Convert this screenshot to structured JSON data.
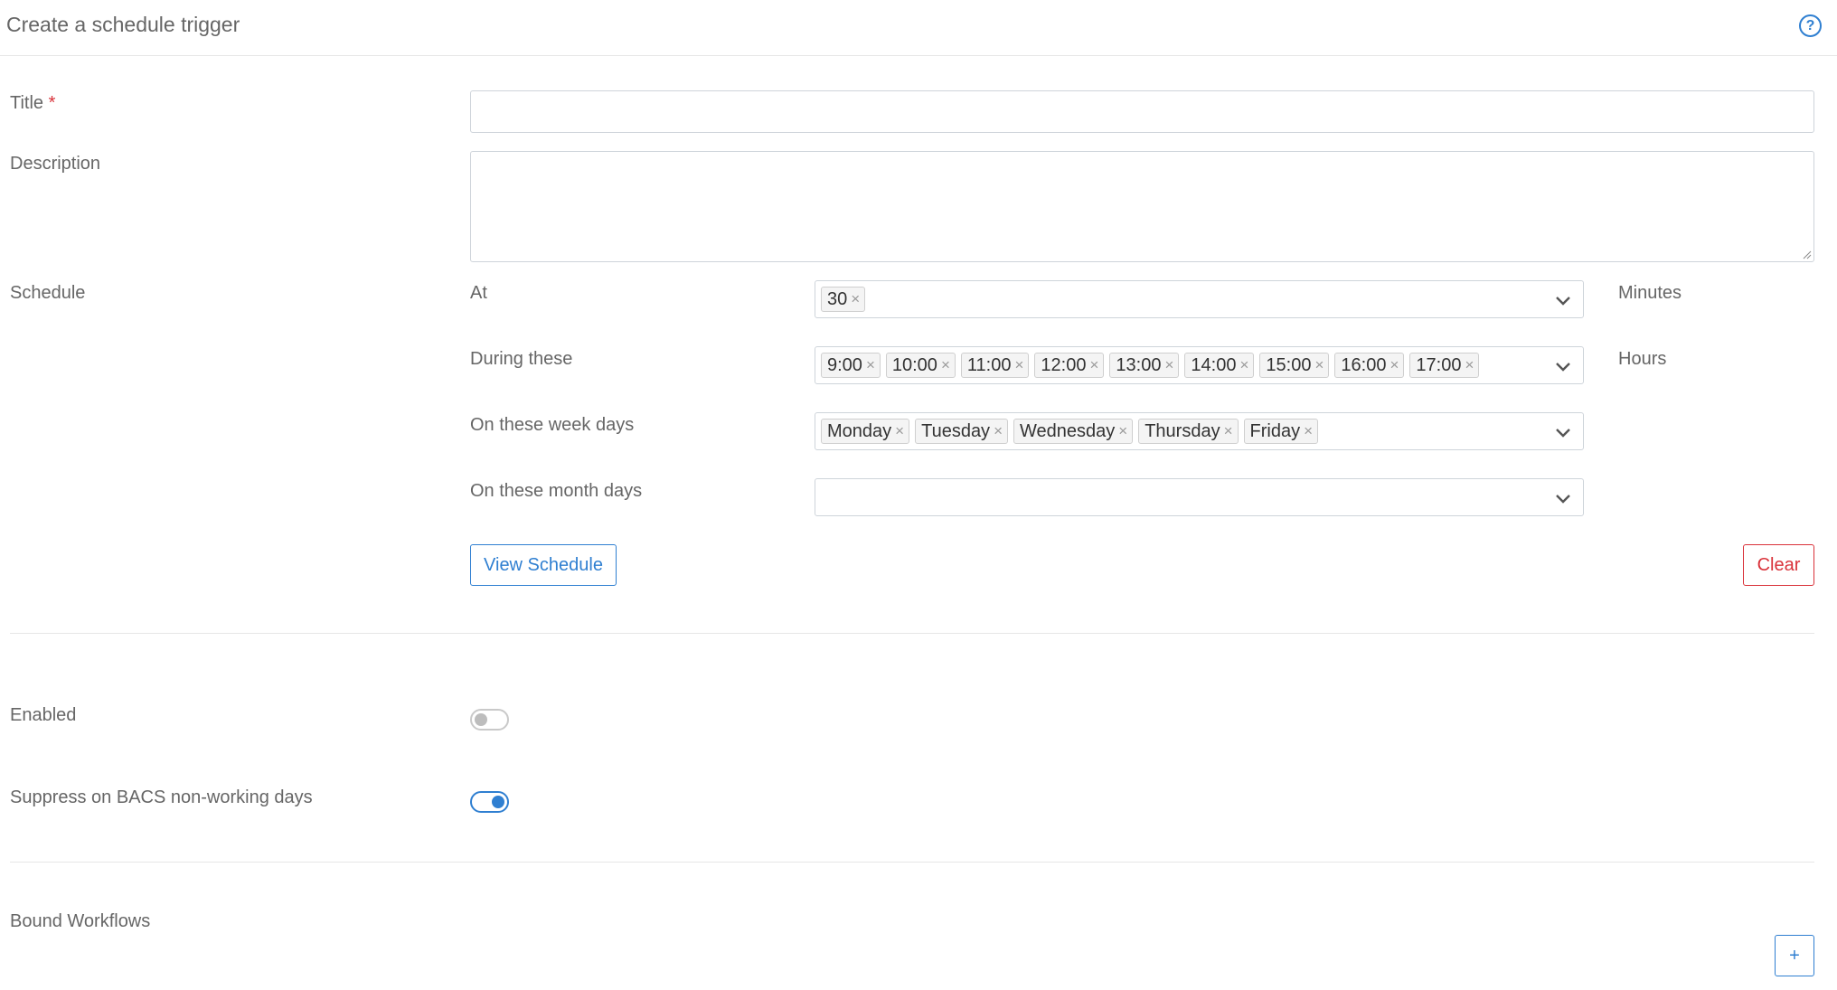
{
  "header": {
    "title": "Create a schedule trigger",
    "help_icon": "question-circle-icon"
  },
  "form": {
    "title_label": "Title",
    "title_required_mark": "*",
    "title_value": "",
    "description_label": "Description",
    "description_value": "",
    "schedule_label": "Schedule",
    "schedule": {
      "at": {
        "label": "At",
        "unit": "Minutes",
        "selected": [
          "30"
        ]
      },
      "hours": {
        "label": "During these",
        "unit": "Hours",
        "selected": [
          "9:00",
          "10:00",
          "11:00",
          "12:00",
          "13:00",
          "14:00",
          "15:00",
          "16:00",
          "17:00"
        ]
      },
      "week_days": {
        "label": "On these week days",
        "selected": [
          "Monday",
          "Tuesday",
          "Wednesday",
          "Thursday",
          "Friday"
        ]
      },
      "month_days": {
        "label": "On these month days",
        "selected": []
      },
      "remove_glyph": "×",
      "view_schedule_button": "View Schedule",
      "clear_button": "Clear"
    },
    "enabled": {
      "label": "Enabled",
      "on": false
    },
    "suppress_bacs": {
      "label": "Suppress on BACS non-working days",
      "on": true
    },
    "bound_workflows": {
      "label": "Bound Workflows",
      "add_button": "+"
    }
  },
  "colors": {
    "accent": "#2f7fd1",
    "danger": "#d9323a",
    "border": "#ced4da"
  }
}
